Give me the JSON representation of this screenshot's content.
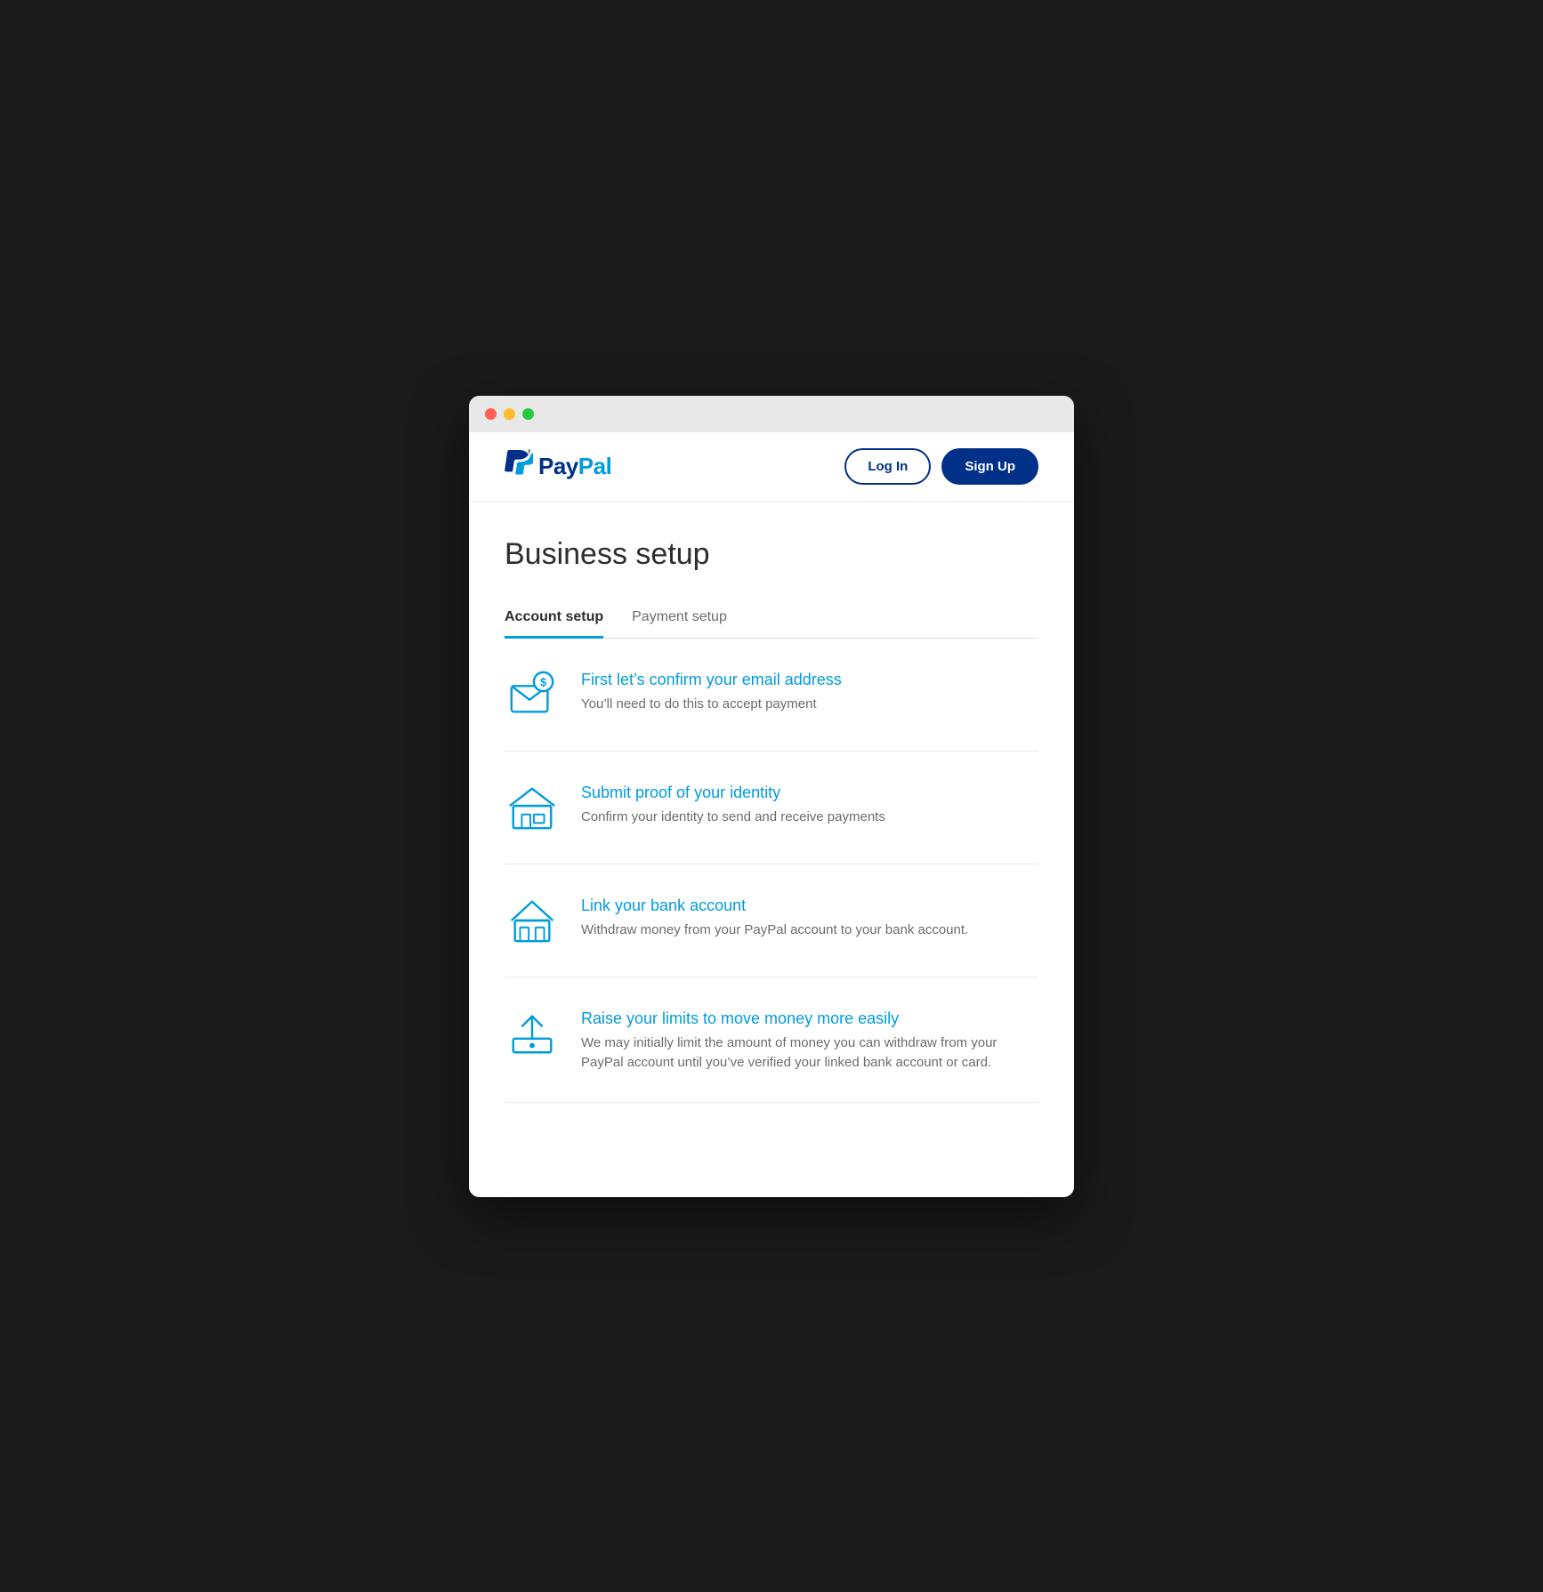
{
  "window": {
    "traffic_lights": [
      "close",
      "minimize",
      "maximize"
    ]
  },
  "navbar": {
    "logo_pay": "Pay",
    "logo_pal": "Pal",
    "login_label": "Log In",
    "signup_label": "Sign Up"
  },
  "page": {
    "title": "Business setup"
  },
  "tabs": [
    {
      "id": "account-setup",
      "label": "Account setup",
      "active": true
    },
    {
      "id": "payment-setup",
      "label": "Payment setup",
      "active": false
    }
  ],
  "setup_items": [
    {
      "id": "confirm-email",
      "title": "First let’s confirm your email address",
      "description": "You’ll need to do this to accept payment",
      "icon": "email"
    },
    {
      "id": "submit-identity",
      "title": "Submit proof of your identity",
      "description": "Confirm your identity to send and receive payments",
      "icon": "store"
    },
    {
      "id": "link-bank",
      "title": "Link your bank account",
      "description": "Withdraw money from your PayPal account to your bank account.",
      "icon": "bank"
    },
    {
      "id": "raise-limits",
      "title": "Raise your limits to move money more easily",
      "description": "We may initially limit the amount of money you can withdraw from your PayPal account until you’ve verified your linked bank account or card.",
      "icon": "upload"
    }
  ],
  "colors": {
    "accent_blue": "#009cde",
    "dark_blue": "#003087",
    "text_dark": "#2c2e2f",
    "text_gray": "#6c6c6c"
  }
}
